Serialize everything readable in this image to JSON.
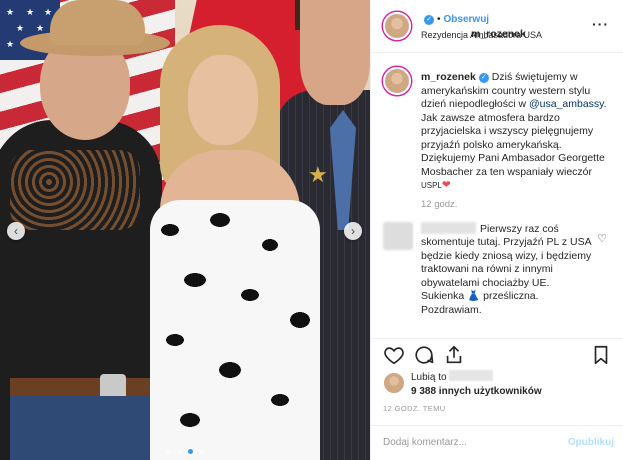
{
  "post": {
    "username": "m_rozenek",
    "follow_sep": "•",
    "follow_label": "Obserwuj",
    "location": "Rezydencja Ambasadora USA",
    "more_icon": "more-options-icon",
    "caption_pre": " Dziś świętujemy w amerykańskim country western stylu dzień niepodległości w ",
    "caption_mention": "@usa_ambassy",
    "caption_post": ". Jak zawsze atmosfera bardzo przyjacielska i wszyscy pielęgnujemy przyjaźń polsko amerykańską. Dziękujemy Pani Ambasador Georgette Mosbacher za ten wspaniały wieczór ",
    "caption_tag": "USPL",
    "caption_heart": "❤",
    "caption_time": "12 godz."
  },
  "comment": {
    "text": "Pierwszy raz coś skomentuje tutaj. Przyjaźń PL z USA będzie kiedy zniosą wizy, i będziemy traktowani na równi z innymi obywatelami chociażby UE. Sukienka 👗 prześliczna. Pozdrawiam.",
    "like_icon": "heart-outline-icon"
  },
  "likes": {
    "prefix": "Lubią to",
    "count_text": "9 388 innych użytkowników"
  },
  "timestamp": "12 GODZ. TEMU",
  "add_comment": {
    "placeholder": "Dodaj komentarz...",
    "post_label": "Opublikuj"
  },
  "colors": {
    "accent": "#3897f0",
    "heart": "#ed4956",
    "mention": "#003569"
  }
}
